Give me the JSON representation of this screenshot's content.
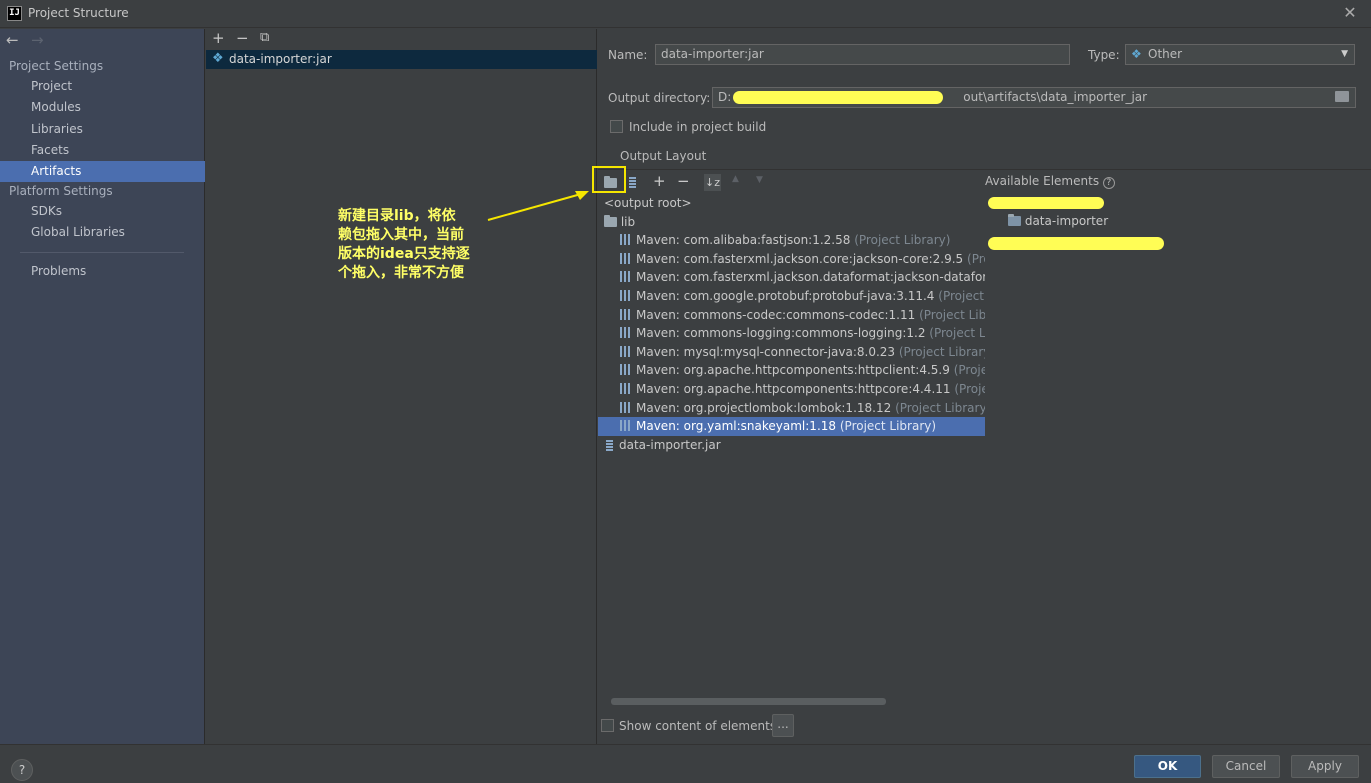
{
  "window": {
    "title": "Project Structure",
    "logo_text": "IJ"
  },
  "sidebar": {
    "project_settings_header": "Project Settings",
    "project_items": [
      {
        "label": "Project"
      },
      {
        "label": "Modules"
      },
      {
        "label": "Libraries"
      },
      {
        "label": "Facets"
      },
      {
        "label": "Artifacts",
        "selected": true
      }
    ],
    "platform_settings_header": "Platform Settings",
    "platform_items": [
      {
        "label": "SDKs"
      },
      {
        "label": "Global Libraries"
      }
    ],
    "problems_label": "Problems"
  },
  "artifacts_list": {
    "toolbar": {
      "add": "+",
      "remove": "−",
      "copy": "⧉"
    },
    "items": [
      {
        "name": "data-importer:jar",
        "selected": true
      }
    ]
  },
  "artifact_detail": {
    "name_label": "Name:",
    "name_value": "data-importer:jar",
    "type_label": "Type:",
    "type_value": "Other",
    "output_dir_label": "Output directory:",
    "output_dir_prefix": "D:",
    "output_dir_suffix": "out\\artifacts\\data_importer_jar",
    "include_in_build_label": "Include in project build",
    "include_in_build_checked": false,
    "output_layout_label": "Output Layout",
    "available_elements_label": "Available Elements",
    "output_tree": {
      "root": "<output root>",
      "lib_folder": "lib",
      "libraries": [
        {
          "name": "Maven: com.alibaba:fastjson:1.2.58",
          "scope": "(Project Library)"
        },
        {
          "name": "Maven: com.fasterxml.jackson.core:jackson-core:2.9.5",
          "scope": "(Project Li"
        },
        {
          "name": "Maven: com.fasterxml.jackson.dataformat:jackson-dataformat-ya",
          "scope": ""
        },
        {
          "name": "Maven: com.google.protobuf:protobuf-java:3.11.4",
          "scope": "(Project Libra"
        },
        {
          "name": "Maven: commons-codec:commons-codec:1.11",
          "scope": "(Project Library)"
        },
        {
          "name": "Maven: commons-logging:commons-logging:1.2",
          "scope": "(Project Library"
        },
        {
          "name": "Maven: mysql:mysql-connector-java:8.0.23",
          "scope": "(Project Library)"
        },
        {
          "name": "Maven: org.apache.httpcomponents:httpclient:4.5.9",
          "scope": "(Project Libra"
        },
        {
          "name": "Maven: org.apache.httpcomponents:httpcore:4.4.11",
          "scope": "(Project Libr"
        },
        {
          "name": "Maven: org.projectlombok:lombok:1.18.12",
          "scope": "(Project Library)"
        },
        {
          "name": "Maven: org.yaml:snakeyaml:1.18",
          "scope": "(Project Library)",
          "selected": true
        }
      ],
      "jar_file": "data-importer.jar"
    },
    "available_tree": {
      "module": "data-importer"
    },
    "show_content_label": "Show content of elements",
    "ellipsis_button": "..."
  },
  "buttons": {
    "ok": "OK",
    "cancel": "Cancel",
    "apply": "Apply",
    "help": "?"
  },
  "annotation": {
    "text": "新建目录lib，将依\n赖包拖入其中，当前\n版本的idea只支持逐\n个拖入，非常不方便"
  },
  "colors": {
    "selection": "#4b6eaf",
    "annotation": "#ffff66",
    "primary_button": "#365880"
  }
}
